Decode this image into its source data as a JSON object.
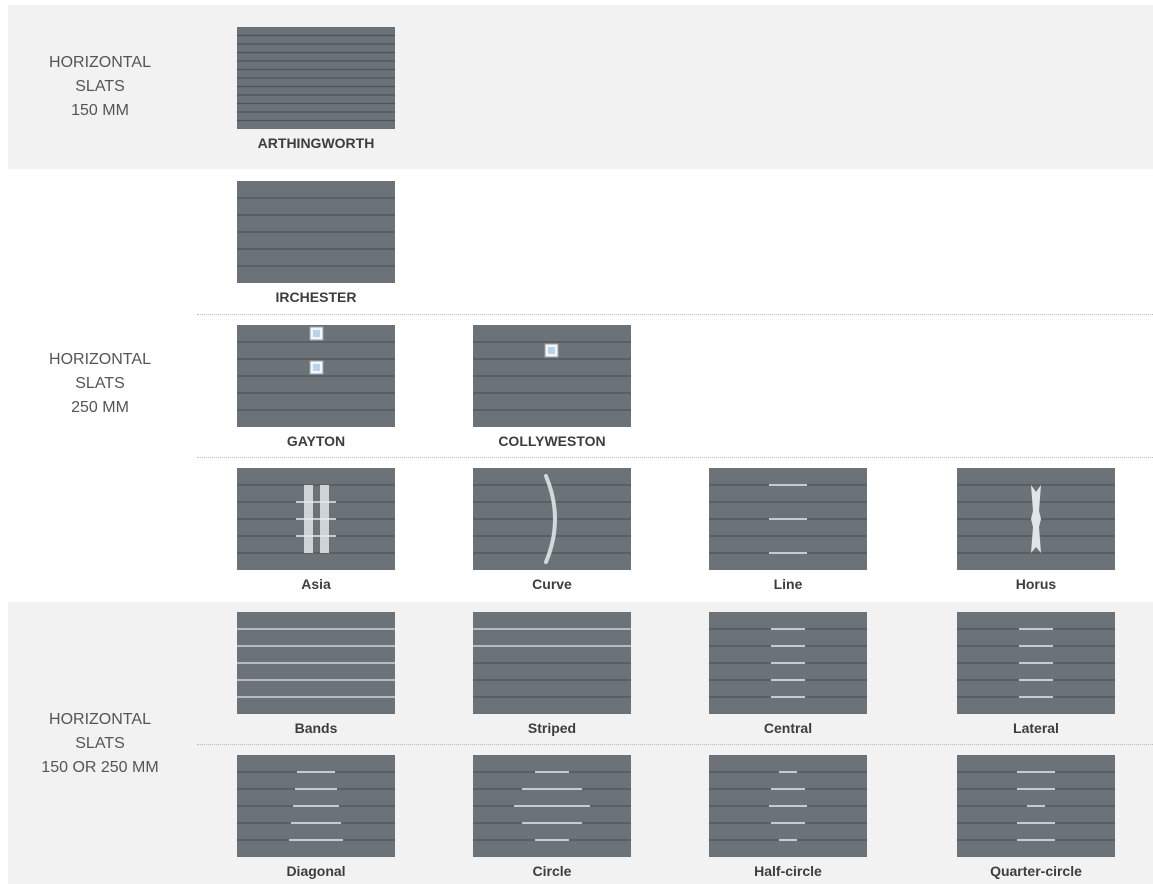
{
  "colors": {
    "panel": "#6b7378",
    "line": "#4d555a",
    "accent": "#e9ebec",
    "shade": "#f2f2f2"
  },
  "groups": [
    {
      "id": "g150",
      "lines": [
        "HORIZONTAL",
        "SLATS",
        "150 MM"
      ]
    },
    {
      "id": "g250",
      "lines": [
        "HORIZONTAL",
        "SLATS",
        "250 MM"
      ]
    },
    {
      "id": "g150or250",
      "lines": [
        "HORIZONTAL",
        "SLATS",
        "150 OR 250 MM"
      ]
    }
  ],
  "models": [
    {
      "name": "ARTHINGWORTH",
      "pattern": "slats-150"
    },
    {
      "name": "IRCHESTER",
      "pattern": "slats-250"
    },
    {
      "name": "GAYTON",
      "pattern": "two-windows"
    },
    {
      "name": "COLLYWESTON",
      "pattern": "one-window"
    },
    {
      "name": "Asia",
      "pattern": "asia"
    },
    {
      "name": "Curve",
      "pattern": "curve"
    },
    {
      "name": "Line",
      "pattern": "line"
    },
    {
      "name": "Horus",
      "pattern": "horus"
    },
    {
      "name": "Bands",
      "pattern": "bands"
    },
    {
      "name": "Striped",
      "pattern": "striped"
    },
    {
      "name": "Central",
      "pattern": "central"
    },
    {
      "name": "Lateral",
      "pattern": "lateral"
    },
    {
      "name": "Diagonal",
      "pattern": "diagonal"
    },
    {
      "name": "Circle",
      "pattern": "circle"
    },
    {
      "name": "Half-circle",
      "pattern": "half-circle"
    },
    {
      "name": "Quarter-circle",
      "pattern": "quarter-circle"
    }
  ]
}
